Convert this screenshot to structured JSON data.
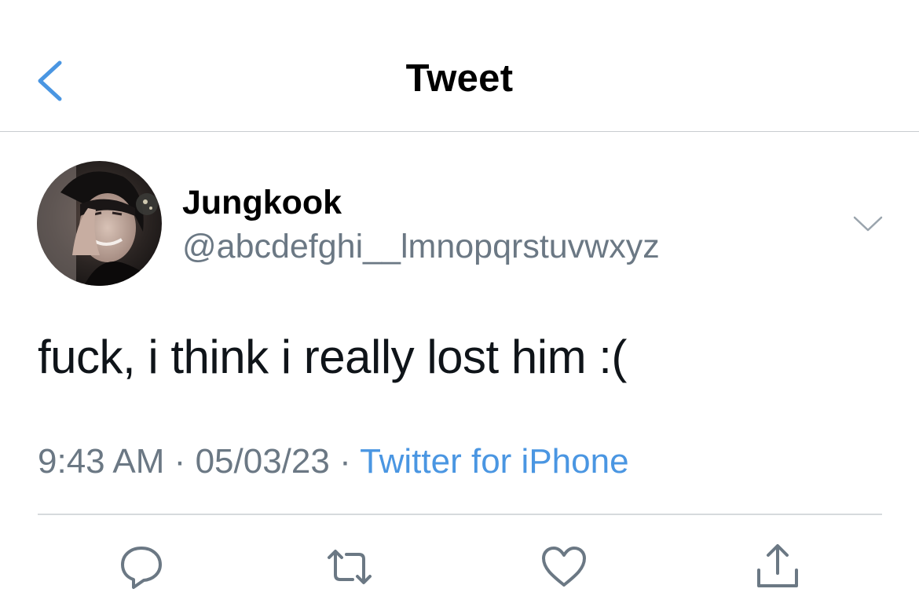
{
  "header": {
    "title": "Tweet",
    "back_icon": "chevron-left-icon"
  },
  "tweet": {
    "author": {
      "display_name": "Jungkook",
      "handle": "@abcdefghi__lmnopqrstuvwxyz"
    },
    "text": "fuck, i think i really lost him :(",
    "meta": {
      "time": "9:43 AM",
      "separator": "·",
      "date": "05/03/23",
      "source": "Twitter for iPhone"
    },
    "actions": [
      "reply-icon",
      "retweet-icon",
      "like-icon",
      "share-icon"
    ]
  },
  "colors": {
    "accent": "#4a96e2",
    "secondary_text": "#6b7884",
    "icon": "#6b7884",
    "primary_text": "#0f1419"
  }
}
